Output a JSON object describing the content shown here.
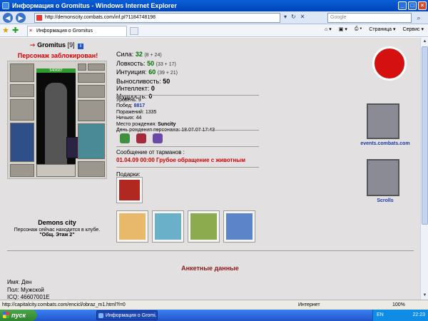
{
  "window": {
    "title": "Информация о Gromitus - Windows Internet Explorer"
  },
  "addressbar": {
    "url": "http://demonscity.combats.com/inf.pl?1184748198",
    "search_placeholder": "Google"
  },
  "tabs": {
    "active_label": "Информация о Gromitus"
  },
  "commandbar": {
    "page_label": "Страница",
    "tools_label": "Сервис"
  },
  "character": {
    "name": "Gromitus",
    "level": "[9]",
    "blocked_text": "Персонаж заблокирован!",
    "hp": "540/687"
  },
  "stats": [
    {
      "label": "Сила:",
      "value": "32",
      "mod": "(8 + 24)"
    },
    {
      "label": "Ловкость:",
      "value": "50",
      "mod": "(33 + 17)"
    },
    {
      "label": "Интуиция:",
      "value": "60",
      "mod": "(39 + 21)"
    },
    {
      "label": "Выносливость:",
      "value": "50",
      "mod": ""
    },
    {
      "label": "Интеллект:",
      "value": "0",
      "mod": ""
    },
    {
      "label": "Мудрость:",
      "value": "0",
      "mod": ""
    }
  ],
  "details": {
    "level_label": "Уровень:",
    "level": "9",
    "wins_label": "Побед:",
    "wins": "8817",
    "losses_label": "Поражений:",
    "losses": "1335",
    "draws_label": "Ничьих:",
    "draws": "44",
    "birthplace_label": "Место рождения:",
    "birthplace": "Suncity",
    "birthday_label": "День рождения персонажа:",
    "birthday": "18.07.07 17:43"
  },
  "message": {
    "heading": "Сообщение от тарманов :",
    "line": "01.04.09 00:00 Грубое обращение с животным"
  },
  "location": {
    "city": "Demons city",
    "club_text": "Персонаж сейчас находится в клубе.",
    "room": "\"Общ. Этаж 2\""
  },
  "gifts": {
    "label": "Подарки:"
  },
  "sidebar": {
    "events_label": "events.combats.com",
    "scrolls_label": "Scrolls"
  },
  "anket": {
    "title": "Анкетные данные",
    "name_label": "Имя:",
    "name": "Ден",
    "gender_label": "Пол:",
    "gender": "Мужской",
    "icq_label": "ICQ:",
    "icq": "46607001E"
  },
  "statusbar": {
    "status_url": "http://capitalcity.combats.com/encicl/obraz_m1.html?l=0",
    "zone": "Интернет",
    "zoom": "100%"
  },
  "taskbar": {
    "start_label": "пуск",
    "task_label": "Информация о Gromi...",
    "lang": "EN",
    "time": "22:23"
  },
  "colors": {
    "page_bg": "#e2e0e0",
    "blocked": "#dd0000",
    "stat_value": "#007000",
    "message": "#d00000",
    "anket_title": "#8b1a1a",
    "link": "#1a3aa8"
  }
}
